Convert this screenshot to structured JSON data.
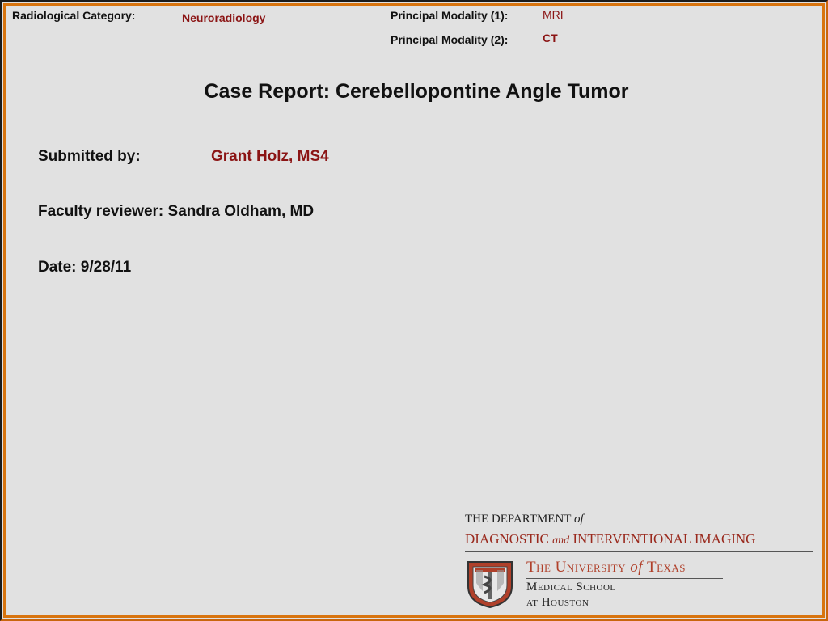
{
  "header": {
    "category_label": "Radiological Category:",
    "category_value": "Neuroradiology",
    "modality1_label": "Principal Modality (1):",
    "modality1_value": "MRI",
    "modality2_label": "Principal Modality (2):",
    "modality2_value": "CT"
  },
  "title": "Case Report: Cerebellopontine Angle Tumor",
  "info": {
    "submitted_label": "Submitted by:",
    "submitted_value": "Grant Holz, MS4",
    "reviewer": "Faculty reviewer: Sandra Oldham, MD",
    "date": "Date: 9/28/11"
  },
  "logo": {
    "dept_line1_a": "THE DEPARTMENT",
    "dept_line1_b": "of",
    "dept_line2_a": "DIAGNOSTIC",
    "dept_line2_b": "and",
    "dept_line2_c": "INTERVENTIONAL IMAGING",
    "ut_line1_a": "The University",
    "ut_line1_b": "of",
    "ut_line1_c": "Texas",
    "ut_line2": "Medical School",
    "ut_line3": "at Houston"
  },
  "colors": {
    "accent_red": "#8b1414",
    "frame_orange": "#d8740f",
    "background": "#e1e1e1"
  }
}
